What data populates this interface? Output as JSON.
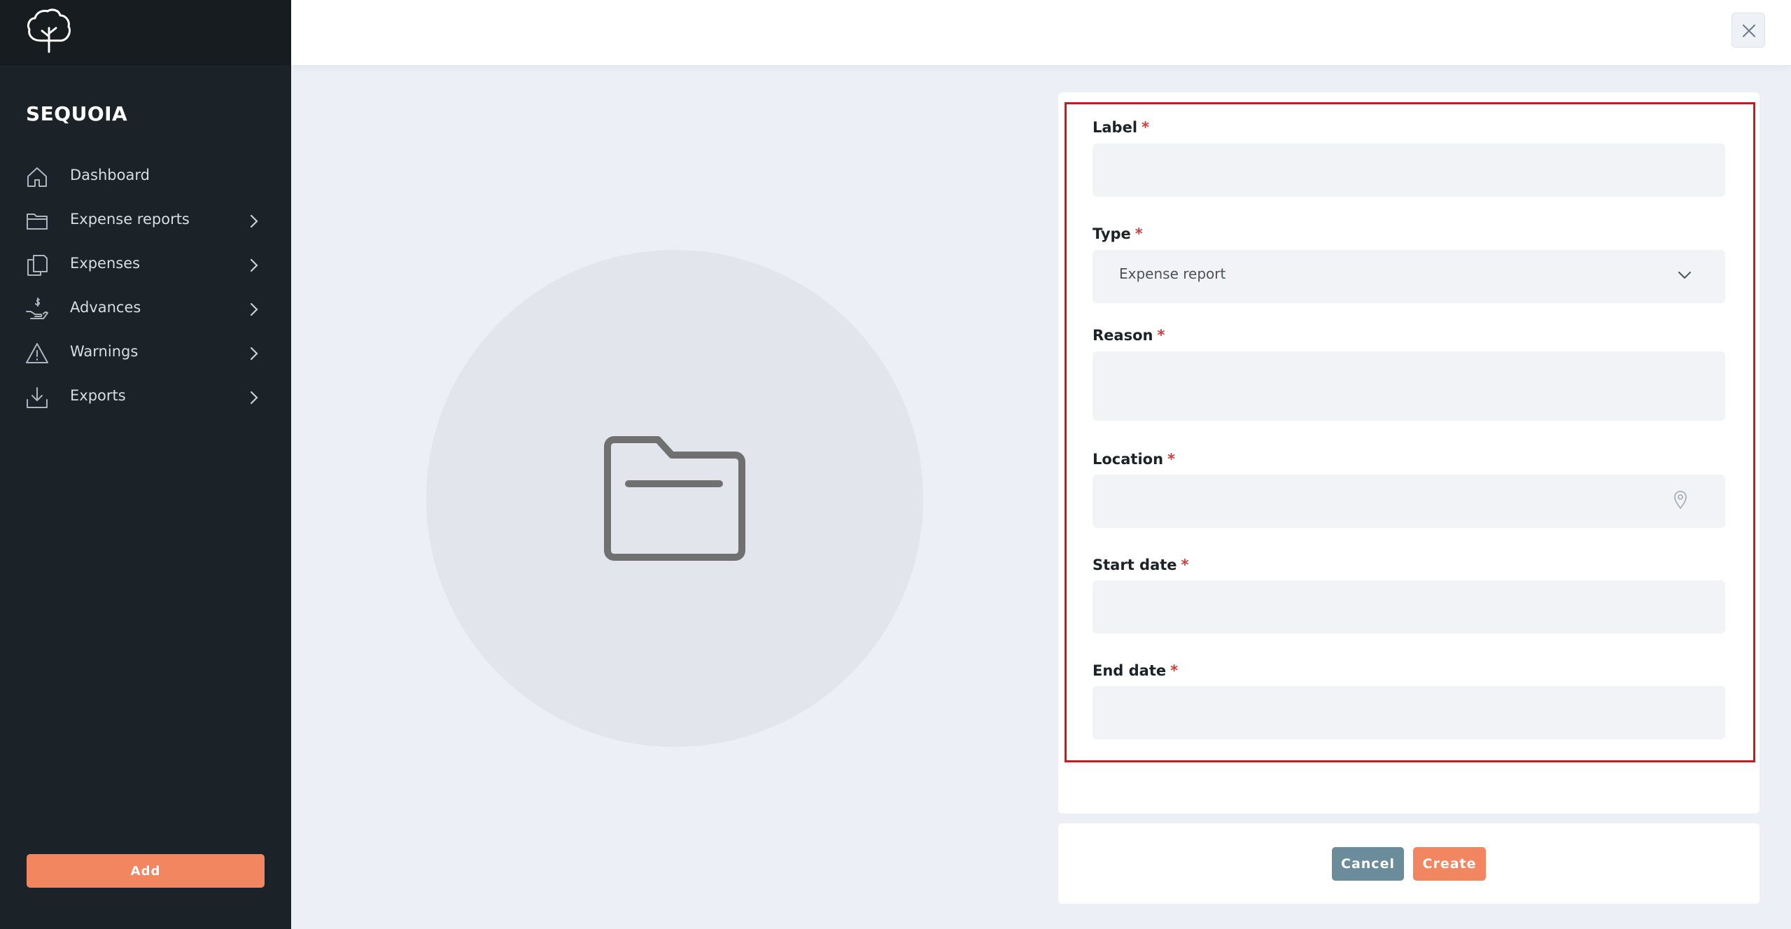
{
  "app": {
    "brand": "SEQUOIA"
  },
  "sidebar": {
    "items": [
      {
        "label": "Dashboard",
        "icon": "home-icon",
        "has_submenu": false
      },
      {
        "label": "Expense reports",
        "icon": "folder-icon",
        "has_submenu": true
      },
      {
        "label": "Expenses",
        "icon": "documents-icon",
        "has_submenu": true
      },
      {
        "label": "Advances",
        "icon": "hand-dollar-icon",
        "has_submenu": true
      },
      {
        "label": "Warnings",
        "icon": "warning-icon",
        "has_submenu": true
      },
      {
        "label": "Exports",
        "icon": "download-icon",
        "has_submenu": true
      }
    ],
    "add_label": "Add"
  },
  "form": {
    "required_marker": "*",
    "label": {
      "label": "Label",
      "value": "",
      "placeholder": ""
    },
    "type": {
      "label": "Type",
      "value": "Expense report"
    },
    "reason": {
      "label": "Reason",
      "value": "",
      "placeholder": ""
    },
    "location": {
      "label": "Location",
      "value": "",
      "placeholder": ""
    },
    "start_date": {
      "label": "Start date",
      "value": "",
      "placeholder": ""
    },
    "end_date": {
      "label": "End date",
      "value": "",
      "placeholder": ""
    }
  },
  "actions": {
    "cancel_label": "Cancel",
    "create_label": "Create"
  },
  "colors": {
    "sidebar_bg": "#1c2328",
    "accent": "#f28660",
    "cancel": "#6b8c9b",
    "highlight": "#d0161c",
    "required": "#d63a3a"
  }
}
